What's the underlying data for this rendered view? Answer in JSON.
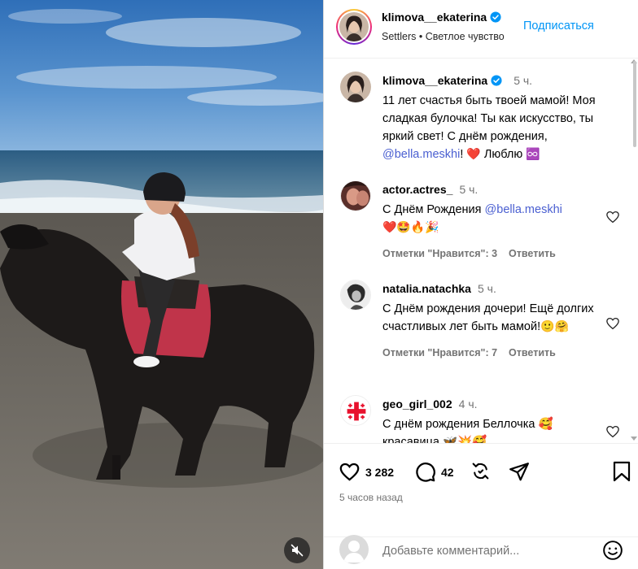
{
  "header": {
    "username": "klimova__ekaterina",
    "subtitle": "Settlers • Светлое чувство",
    "follow_label": "Подписаться"
  },
  "caption": {
    "username": "klimova__ekaterina",
    "time": "5 ч.",
    "text_1": "11 лет счастья быть твоей мамой! Моя сладкая булочка! Ты как искусство, ты яркий свет! С днём рождения,",
    "mention": "@bella.meskhi",
    "text_2": "! ",
    "text_3": " Люблю",
    "emoji_heart": "❤️",
    "emoji_infinity": "♾️"
  },
  "comments": [
    {
      "username": "actor.actres_",
      "time": "5 ч.",
      "text": "С Днём Рождения ",
      "mention": "@bella.meskhi",
      "emojis": "❤️🤩🔥🎉",
      "likes": "Отметки \"Нравится\": 3",
      "reply": "Ответить"
    },
    {
      "username": "natalia.natachka",
      "time": "5 ч.",
      "text": "С Днём рождения дочери! Ещё долгих счастливых лет быть мамой!",
      "emojis": "🙂🤗",
      "likes": "Отметки \"Нравится\": 7",
      "reply": "Ответить"
    },
    {
      "username": "geo_girl_002",
      "time": "4 ч.",
      "text": "С днём рождения Беллочка 🥰 красавица 🦋💥🥰"
    }
  ],
  "actions": {
    "likes_count": "3 282",
    "comments_count": "42",
    "posted_ago": "5 часов назад"
  },
  "add_comment": {
    "placeholder": "Добавьте комментарий..."
  },
  "colors": {
    "link_blue": "#0095f6",
    "mention": "#4a5fd1",
    "muted": "#737373"
  }
}
